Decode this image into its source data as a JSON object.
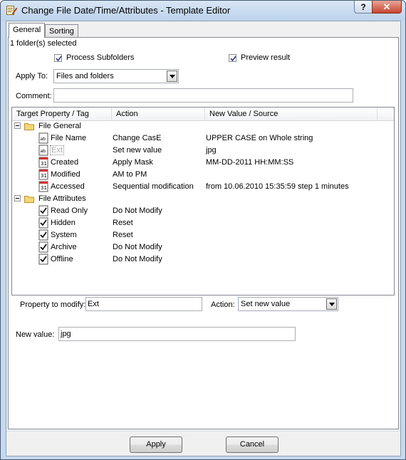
{
  "window": {
    "title": "Change File Date/Time/Attributes - Template Editor",
    "help_glyph": "?",
    "close_glyph": "✕"
  },
  "tabs": [
    {
      "label": "General"
    },
    {
      "label": "Sorting"
    }
  ],
  "general": {
    "folders_selected": "1 folder(s) selected",
    "process_subfolders": {
      "label": "Process Subfolders",
      "checked": true
    },
    "preview_result": {
      "label": "Preview result",
      "checked": true
    },
    "apply_to": {
      "label": "Apply To:",
      "value": "Files and folders"
    },
    "comment": {
      "label": "Comment:",
      "value": ""
    }
  },
  "grid": {
    "columns": [
      "Target Property / Tag",
      "Action",
      "New Value / Source"
    ],
    "groups": [
      {
        "label": "File General",
        "items": [
          {
            "icon": "text-file-icon",
            "label": "File Name",
            "action": "Change CasE",
            "new_value": "UPPER CASE on Whole string"
          },
          {
            "icon": "text-file-icon",
            "label": "Ext",
            "action": "Set new value",
            "new_value": "jpg",
            "selected": true
          },
          {
            "icon": "calendar-icon",
            "label": "Created",
            "action": "Apply Mask",
            "new_value": "MM-DD-2011 HH:MM:SS"
          },
          {
            "icon": "calendar-icon",
            "label": "Modified",
            "action": "AM to PM",
            "new_value": ""
          },
          {
            "icon": "calendar-icon",
            "label": "Accessed",
            "action": "Sequential modification",
            "new_value": "from 10.06.2010 15:35:59 step 1 minutes"
          }
        ]
      },
      {
        "label": "File Attributes",
        "items": [
          {
            "icon": "checkbox-icon",
            "label": "Read Only",
            "action": "Do Not Modify",
            "new_value": ""
          },
          {
            "icon": "checkbox-icon",
            "label": "Hidden",
            "action": "Reset",
            "new_value": ""
          },
          {
            "icon": "checkbox-icon",
            "label": "System",
            "action": "Reset",
            "new_value": ""
          },
          {
            "icon": "checkbox-icon",
            "label": "Archive",
            "action": "Do Not Modify",
            "new_value": ""
          },
          {
            "icon": "checkbox-icon",
            "label": "Offline",
            "action": "Do Not Modify",
            "new_value": ""
          }
        ]
      }
    ]
  },
  "editor": {
    "property_label": "Property to modify:",
    "property_value": "Ext",
    "action_label": "Action:",
    "action_value": "Set new value",
    "new_value_label": "New value:",
    "new_value": "jpg"
  },
  "footer": {
    "apply_label": "Apply",
    "cancel_label": "Cancel"
  }
}
